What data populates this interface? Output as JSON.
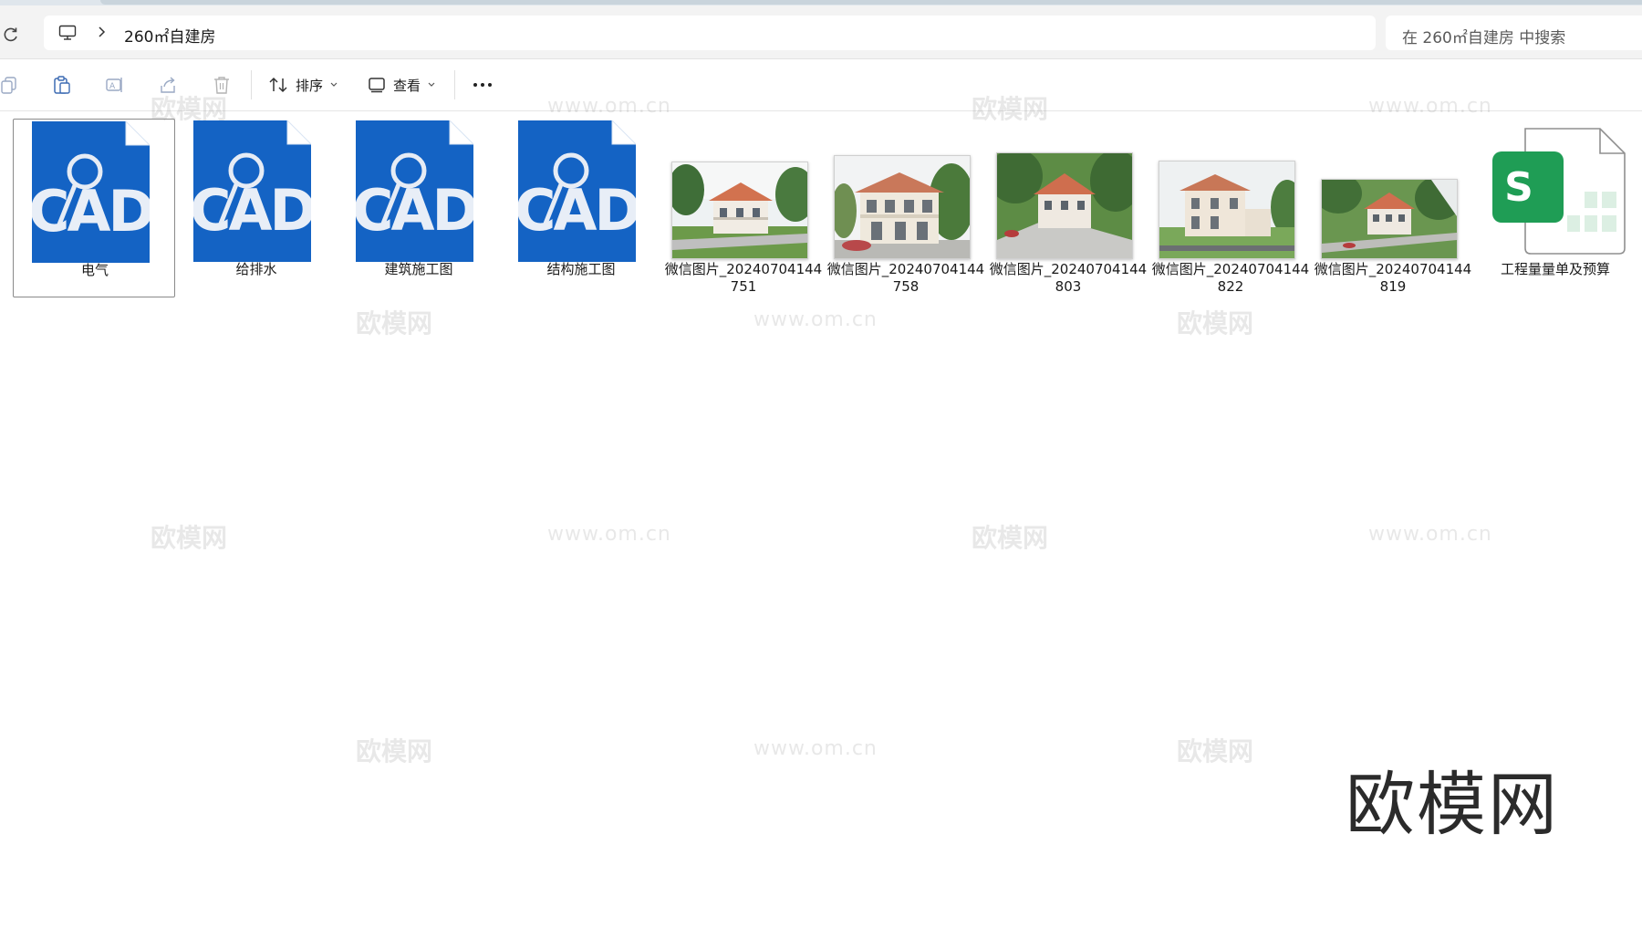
{
  "address": {
    "breadcrumb": "260㎡自建房",
    "search_placeholder": "在 260㎡自建房 中搜索"
  },
  "toolbar": {
    "icons": [
      "copy-icon",
      "paste-icon",
      "rename-icon",
      "share-icon",
      "delete-icon"
    ],
    "sort_label": "排序",
    "view_label": "查看"
  },
  "files": [
    {
      "type": "cad",
      "label": "电气",
      "selected": true
    },
    {
      "type": "cad",
      "label": "给排水"
    },
    {
      "type": "cad",
      "label": "建筑施工图"
    },
    {
      "type": "cad",
      "label": "结构施工图"
    },
    {
      "type": "image",
      "label": "微信图片_20240704144751"
    },
    {
      "type": "image",
      "label": "微信图片_20240704144758"
    },
    {
      "type": "image",
      "label": "微信图片_20240704144803"
    },
    {
      "type": "image",
      "label": "微信图片_20240704144822"
    },
    {
      "type": "image",
      "label": "微信图片_20240704144819"
    },
    {
      "type": "spreadsheet",
      "label": "工程量量单及预算"
    }
  ],
  "cad_icon_text": "CAD",
  "sheet_icon_letter": "S",
  "watermark": {
    "brand": "欧模网",
    "url": "www.om.cn"
  },
  "colors": {
    "cad_blue": "#1463c4",
    "sheet_green": "#1f9d55"
  }
}
